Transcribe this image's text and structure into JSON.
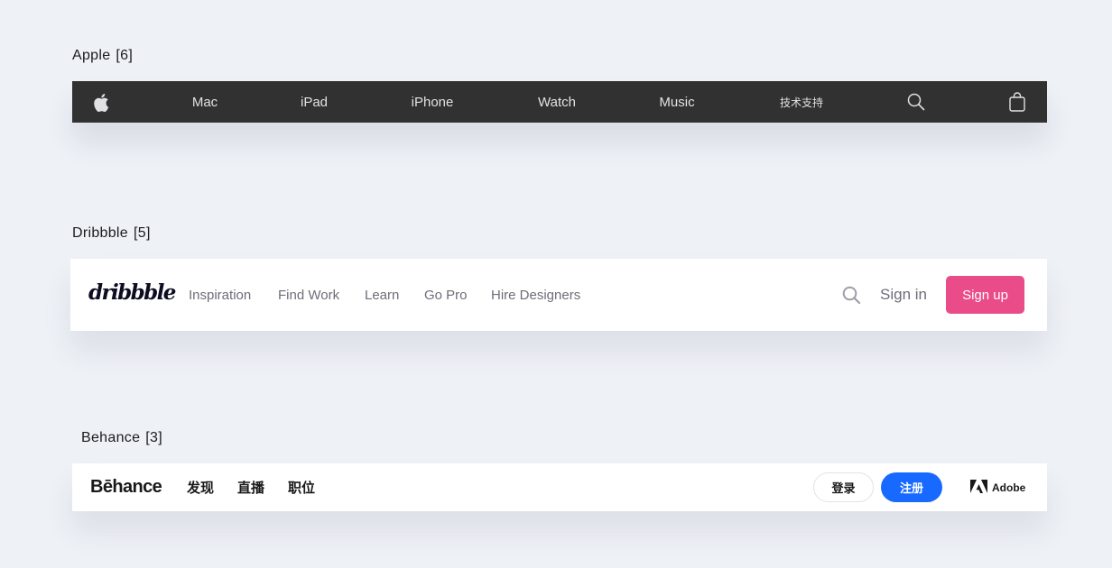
{
  "apple": {
    "section_label": "Apple",
    "count": "[6]",
    "nav": {
      "mac": "Mac",
      "ipad": "iPad",
      "iphone": "iPhone",
      "watch": "Watch",
      "music": "Music",
      "support": "技术支持"
    },
    "icons": [
      "apple-logo-icon",
      "search-icon",
      "shopping-bag-icon"
    ]
  },
  "dribbble": {
    "section_label": "Dribbble",
    "count": "[5]",
    "logo": "dribbble",
    "nav": {
      "inspiration": "Inspiration",
      "find_work": "Find Work",
      "learn": "Learn",
      "go_pro": "Go Pro",
      "hire_designers": "Hire Designers"
    },
    "sign_in": "Sign in",
    "sign_up": "Sign up",
    "accent_color": "#ea4c89",
    "icons": [
      "search-icon"
    ]
  },
  "behance": {
    "section_label": "Behance",
    "count": "[3]",
    "logo": "Bēhance",
    "nav": {
      "discover": "发现",
      "live": "直播",
      "jobs": "职位"
    },
    "login": "登录",
    "register": "注册",
    "adobe": "Adobe",
    "accent_color": "#1769ff",
    "icons": [
      "adobe-logo-icon"
    ]
  }
}
